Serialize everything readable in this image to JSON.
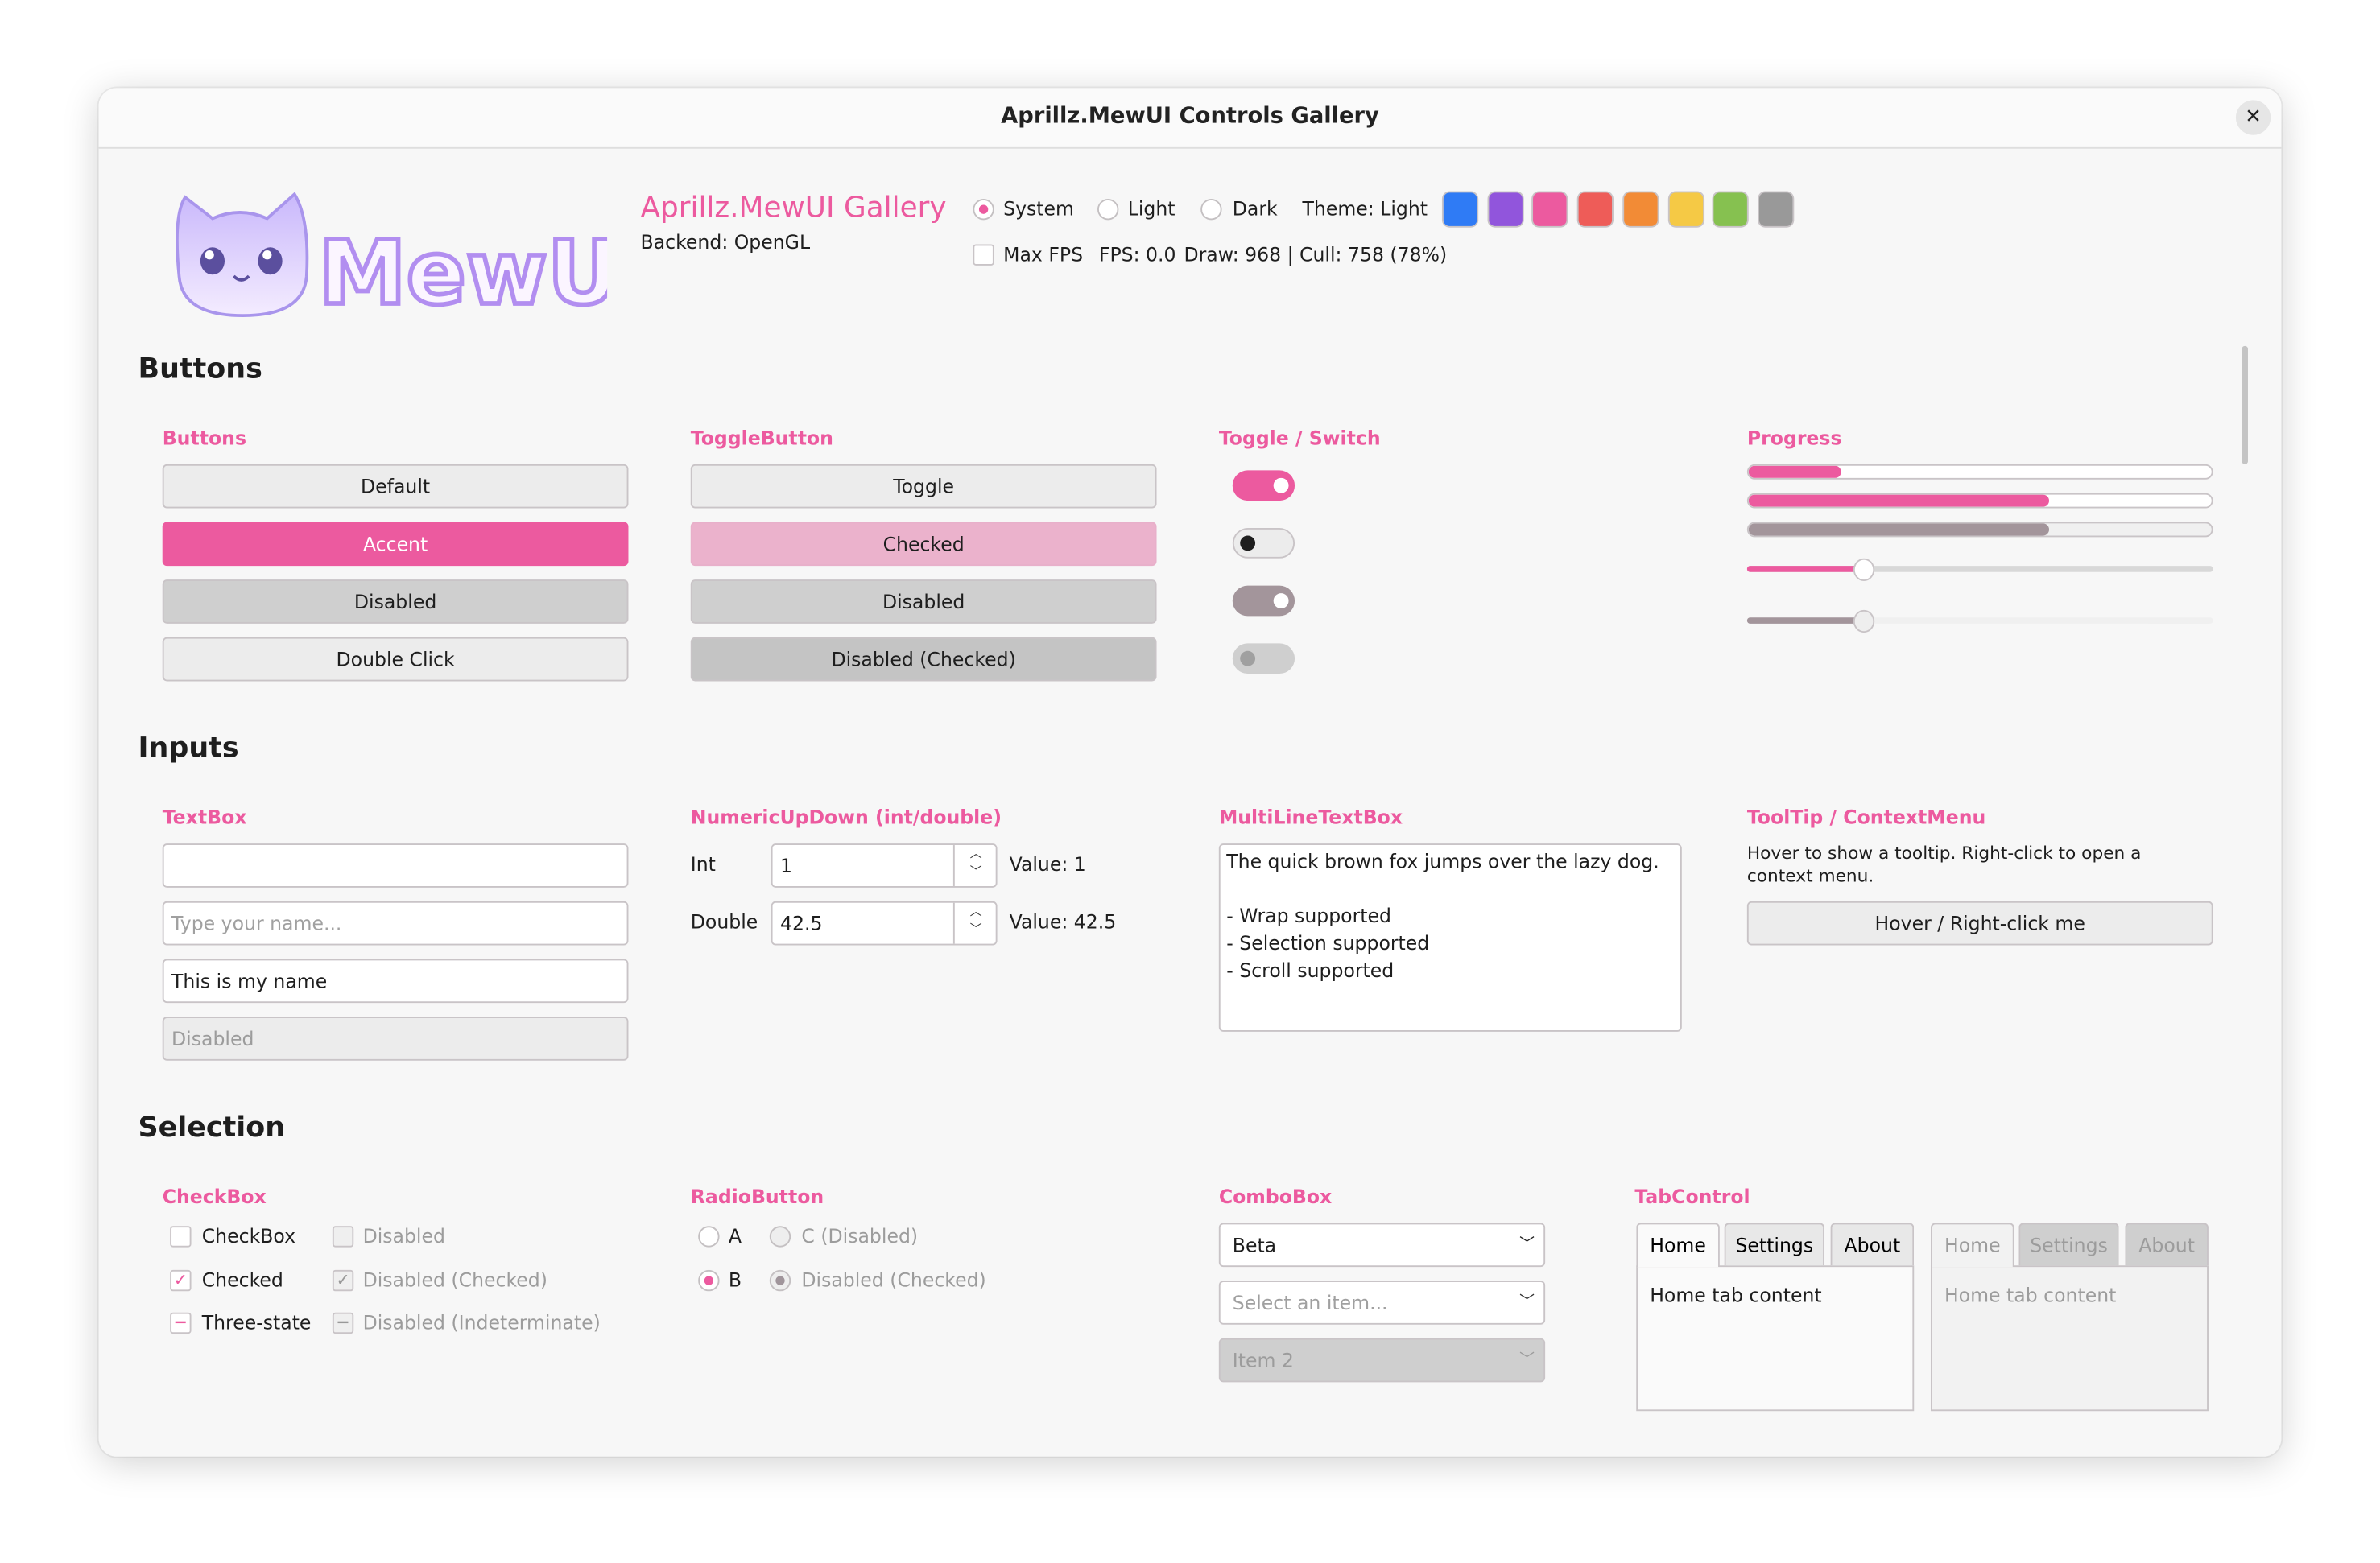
{
  "window": {
    "title": "Aprillz.MewUI Controls Gallery",
    "close_icon": "close-icon"
  },
  "header": {
    "logo_text": "MewUI",
    "app_title": "Aprillz.MewUI Gallery",
    "backend": "Backend: OpenGL",
    "theme_options": [
      "System",
      "Light",
      "Dark"
    ],
    "theme_selected": "System",
    "theme_label": "Theme: Light",
    "accent_colors": [
      "#2f7bf5",
      "#9155dc",
      "#ec5a9f",
      "#ee5c58",
      "#f28b36",
      "#f5c945",
      "#86c150",
      "#999999"
    ],
    "max_fps_label": "Max FPS",
    "max_fps_checked": false,
    "fps": "FPS: 0.0",
    "draw": "Draw: 968 | Cull: 758 (78%)"
  },
  "accent": "#ec5a9f",
  "buttons_section": {
    "title": "Buttons",
    "buttons": {
      "header": "Buttons",
      "items": [
        "Default",
        "Accent",
        "Disabled",
        "Double Click"
      ]
    },
    "toggle": {
      "header": "ToggleButton",
      "items": [
        "Toggle",
        "Checked",
        "Disabled",
        "Disabled (Checked)"
      ]
    },
    "switch": {
      "header": "Toggle / Switch",
      "states": [
        true,
        false,
        true,
        false
      ]
    },
    "progress": {
      "header": "Progress",
      "bars": [
        0.2,
        0.65,
        0.65
      ],
      "sliders": [
        0.25,
        0.25
      ]
    }
  },
  "inputs_section": {
    "title": "Inputs",
    "textbox": {
      "header": "TextBox",
      "values": [
        "",
        "",
        "This is my name",
        "Disabled"
      ],
      "placeholder": "Type your name..."
    },
    "numeric": {
      "header": "NumericUpDown (int/double)",
      "rows": [
        {
          "label": "Int",
          "value": "1",
          "readout": "Value: 1"
        },
        {
          "label": "Double",
          "value": "42.5",
          "readout": "Value: 42.5"
        }
      ]
    },
    "multiline": {
      "header": "MultiLineTextBox",
      "lines": [
        "The quick brown fox jumps over the lazy dog.",
        "",
        "- Wrap supported",
        "- Selection supported",
        "- Scroll supported"
      ]
    },
    "tooltip": {
      "header": "ToolTip / ContextMenu",
      "text": "Hover to show a tooltip. Right-click to open a context menu.",
      "button": "Hover / Right-click me"
    }
  },
  "selection_section": {
    "title": "Selection",
    "checkbox": {
      "header": "CheckBox",
      "items": [
        "CheckBox",
        "Checked",
        "Three-state"
      ],
      "disabled_items": [
        "Disabled",
        "Disabled (Checked)",
        "Disabled (Indeterminate)"
      ]
    },
    "radio": {
      "header": "RadioButton",
      "items": [
        "A",
        "B"
      ],
      "disabled_items": [
        "C (Disabled)",
        "Disabled (Checked)"
      ]
    },
    "combo": {
      "header": "ComboBox",
      "items": [
        "Beta",
        "Select an item...",
        "Item 2"
      ]
    },
    "tabs": {
      "header": "TabControl",
      "labels": [
        "Home",
        "Settings",
        "About"
      ],
      "content": "Home tab content"
    }
  }
}
